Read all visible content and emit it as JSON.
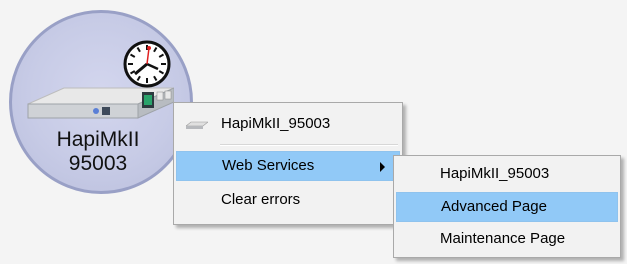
{
  "device": {
    "name_line1": "HapiMkII",
    "name_line2": "95003",
    "icon": "rack-device-icon",
    "badge_icon": "clock-icon"
  },
  "context_menu": {
    "items": [
      {
        "label": "HapiMkII_95003",
        "icon": "device-icon"
      },
      {
        "label": "Web Services",
        "has_submenu": true,
        "highlighted": true
      },
      {
        "label": "Clear errors"
      }
    ]
  },
  "submenu": {
    "items": [
      {
        "label": "HapiMkII_95003"
      },
      {
        "label": "Advanced Page",
        "highlighted": true
      },
      {
        "label": "Maintenance Page"
      }
    ]
  },
  "colors": {
    "highlight": "#91c9f7",
    "menu_background": "#f2f2f2",
    "node_fill": "#c7cbe6",
    "node_border": "#99a0c6"
  }
}
